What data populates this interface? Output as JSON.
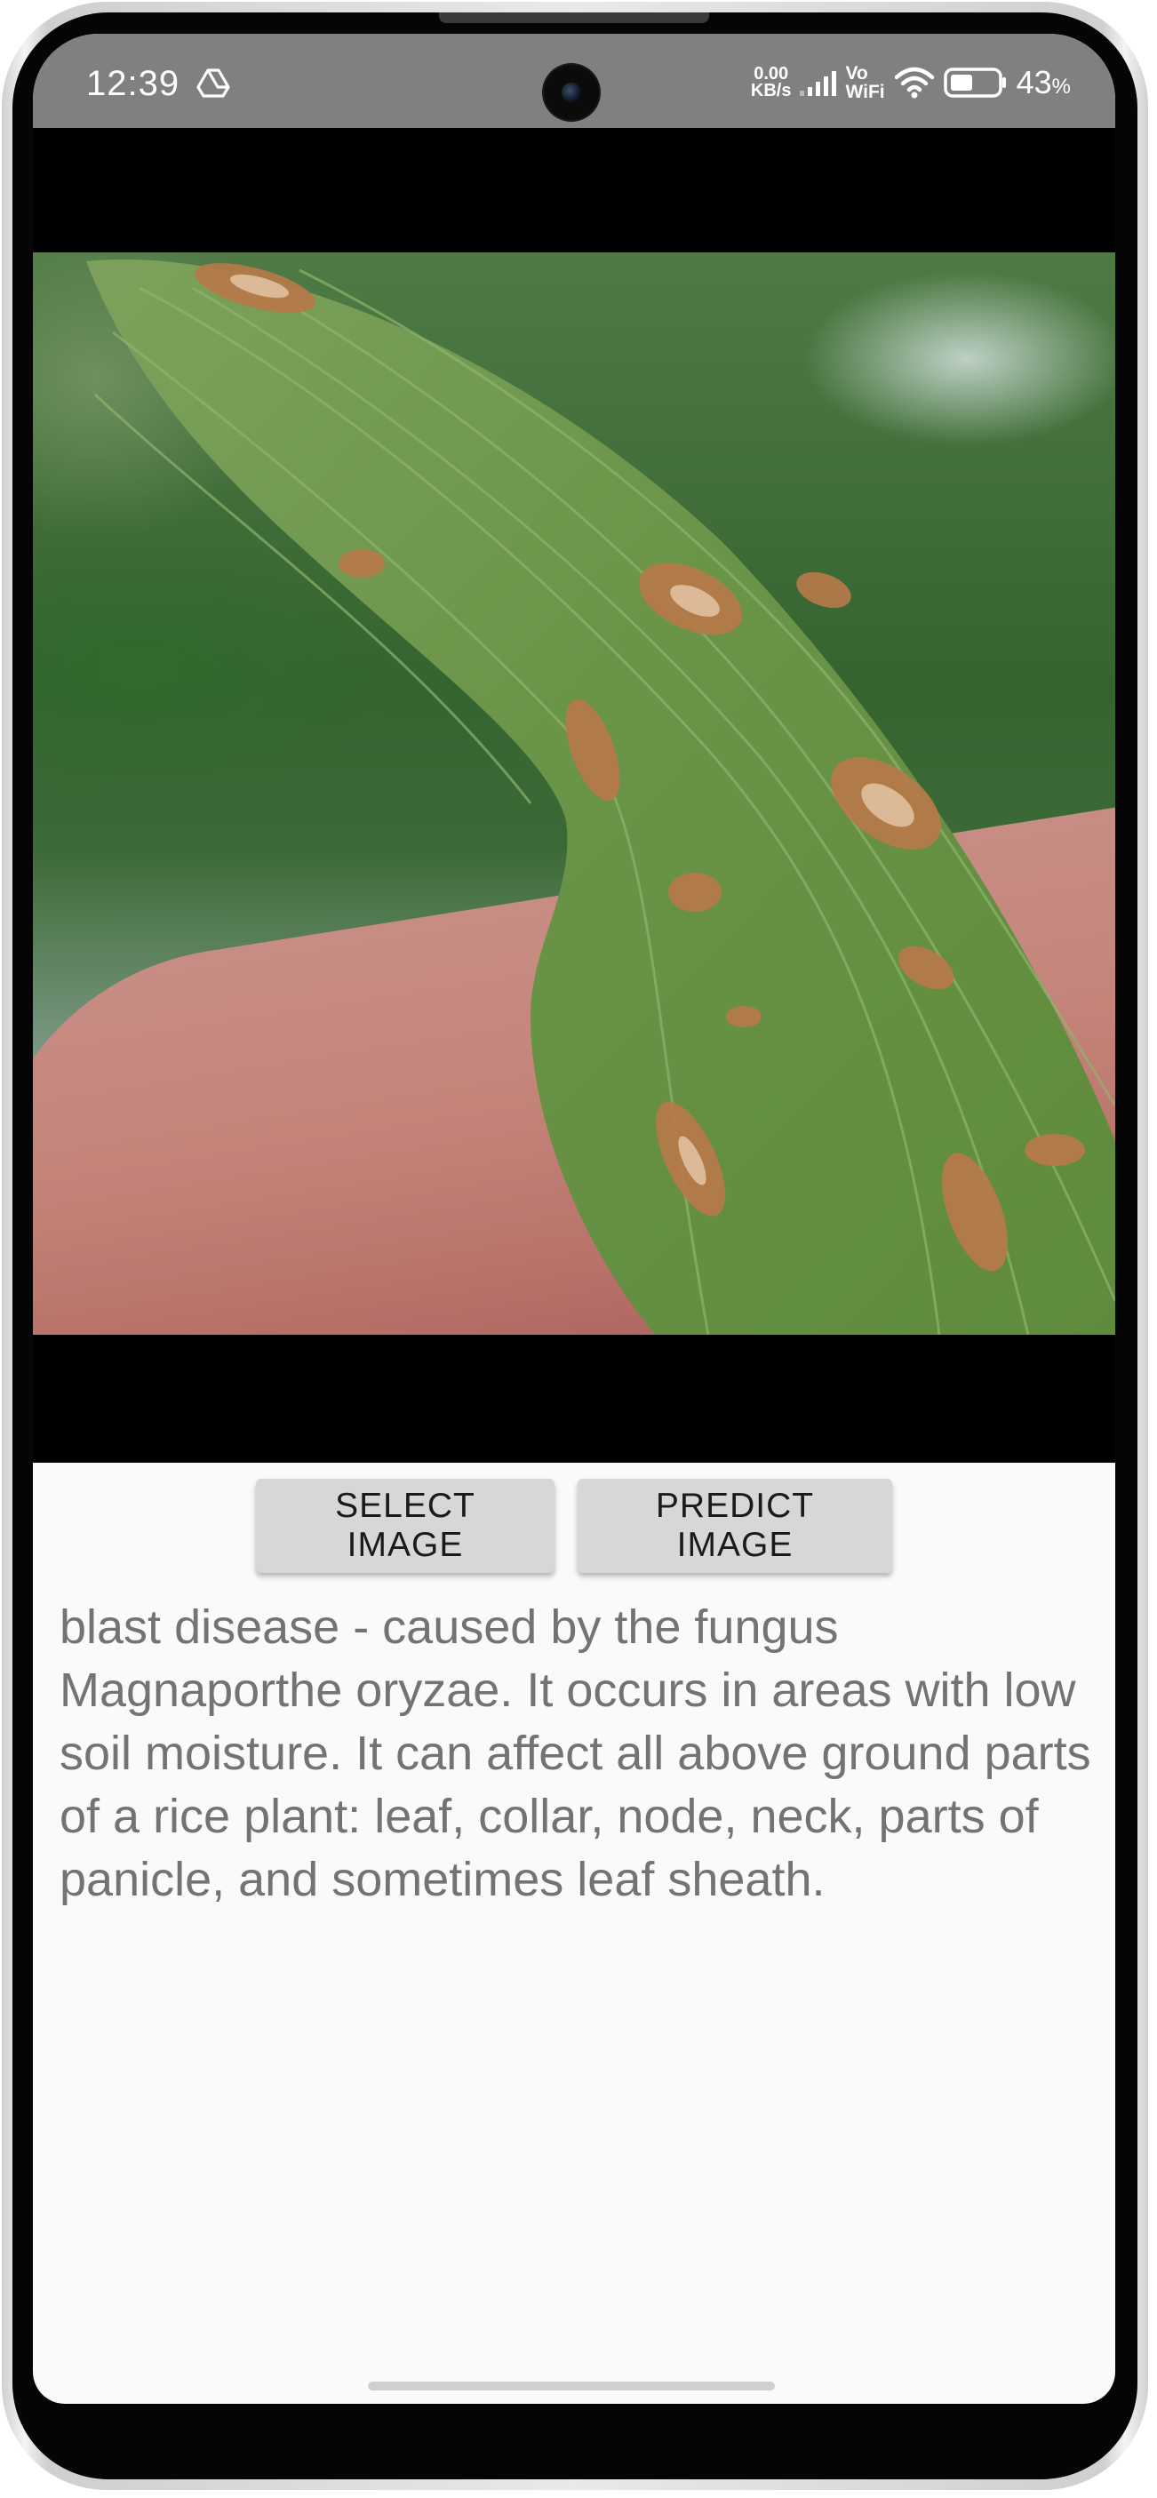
{
  "status_bar": {
    "time": "12:39",
    "drive_icon": "drive-icon",
    "net_speed_value": "0.00",
    "net_speed_unit": "KB/s",
    "vowifi_line1": "Vo",
    "vowifi_line2": "WiFi",
    "battery_percent": "43",
    "battery_symbol": "%"
  },
  "image_view": {
    "description_icon": "photo-leaf"
  },
  "buttons": {
    "select_label": "SELECT IMAGE",
    "predict_label": "PREDICT IMAGE"
  },
  "result": {
    "text": "blast disease - caused by the fungus Magnaporthe oryzae. It occurs in areas with low soil moisture. It can affect all above ground parts of a rice plant: leaf, collar, node, neck, parts of panicle, and sometimes leaf sheath."
  },
  "colors": {
    "status_bar_bg": "#808080",
    "button_bg": "#d6d7d7",
    "result_text": "#737373",
    "screen_bg": "#fafafa"
  }
}
